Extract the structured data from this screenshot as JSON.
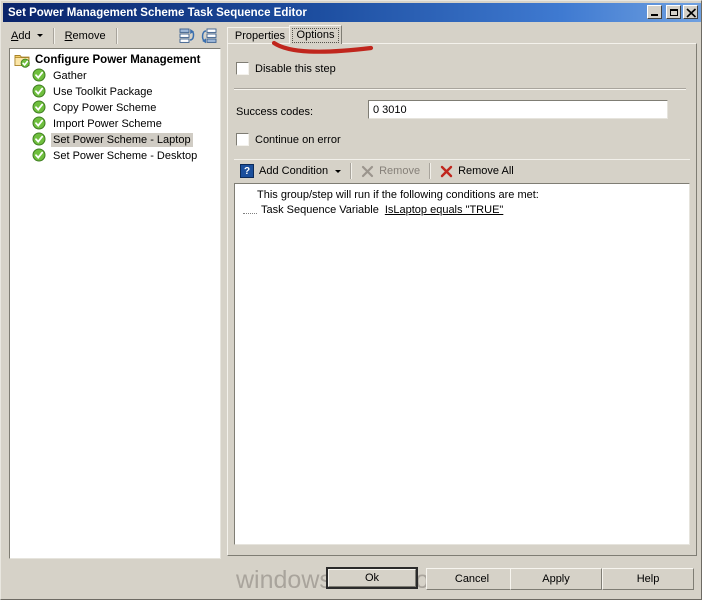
{
  "window": {
    "title": "Set Power Management Scheme Task Sequence Editor",
    "buttons": {
      "minimize": "minimize-button",
      "maximize": "maximize-button",
      "close": "close-button"
    }
  },
  "toolbar": {
    "add_label": "Add",
    "remove_label": "Remove",
    "icon_move_up": "move-step-up-icon",
    "icon_move_down": "move-step-down-icon"
  },
  "tree": {
    "root": {
      "label": "Configure Power Management",
      "icon": "folder-group-icon"
    },
    "items": [
      {
        "label": "Gather",
        "icon": "green-check-icon",
        "selected": false
      },
      {
        "label": "Use Toolkit Package",
        "icon": "green-check-icon",
        "selected": false
      },
      {
        "label": "Copy Power Scheme",
        "icon": "green-check-icon",
        "selected": false
      },
      {
        "label": "Import Power Scheme",
        "icon": "green-check-icon",
        "selected": false
      },
      {
        "label": "Set Power Scheme - Laptop",
        "icon": "green-check-icon",
        "selected": true
      },
      {
        "label": "Set Power Scheme - Desktop",
        "icon": "green-check-icon",
        "selected": false
      }
    ]
  },
  "tabs": [
    {
      "label": "Properties",
      "active": false
    },
    {
      "label": "Options",
      "active": true
    }
  ],
  "options": {
    "disable_step": {
      "label": "Disable this step",
      "checked": false
    },
    "success_codes": {
      "label": "Success codes:",
      "value": "0 3010"
    },
    "continue_on_error": {
      "label": "Continue on error",
      "checked": false
    },
    "condition_toolbar": {
      "add_condition": "Add Condition",
      "add_condition_icon": "question-mark-icon",
      "remove": "Remove",
      "remove_icon": "gray-x-icon",
      "remove_all": "Remove All",
      "remove_all_icon": "red-x-icon"
    },
    "conditions": {
      "header": "This group/step will run if the following conditions are met:",
      "rows": [
        {
          "type": "Task Sequence Variable",
          "expression": "IsLaptop equals \"TRUE\""
        }
      ]
    }
  },
  "footer": {
    "ok": "Ok",
    "cancel": "Cancel",
    "apply": "Apply",
    "help": "Help"
  },
  "watermark": "windows-noob.com",
  "colors": {
    "titlebar_start": "#0a246a",
    "titlebar_end": "#6fa0e0",
    "face": "#d6d2c8",
    "selection": "#d0ccc4",
    "annotation": "#c0261d",
    "green_check": "#5aa832",
    "red_x": "#c0261d"
  }
}
